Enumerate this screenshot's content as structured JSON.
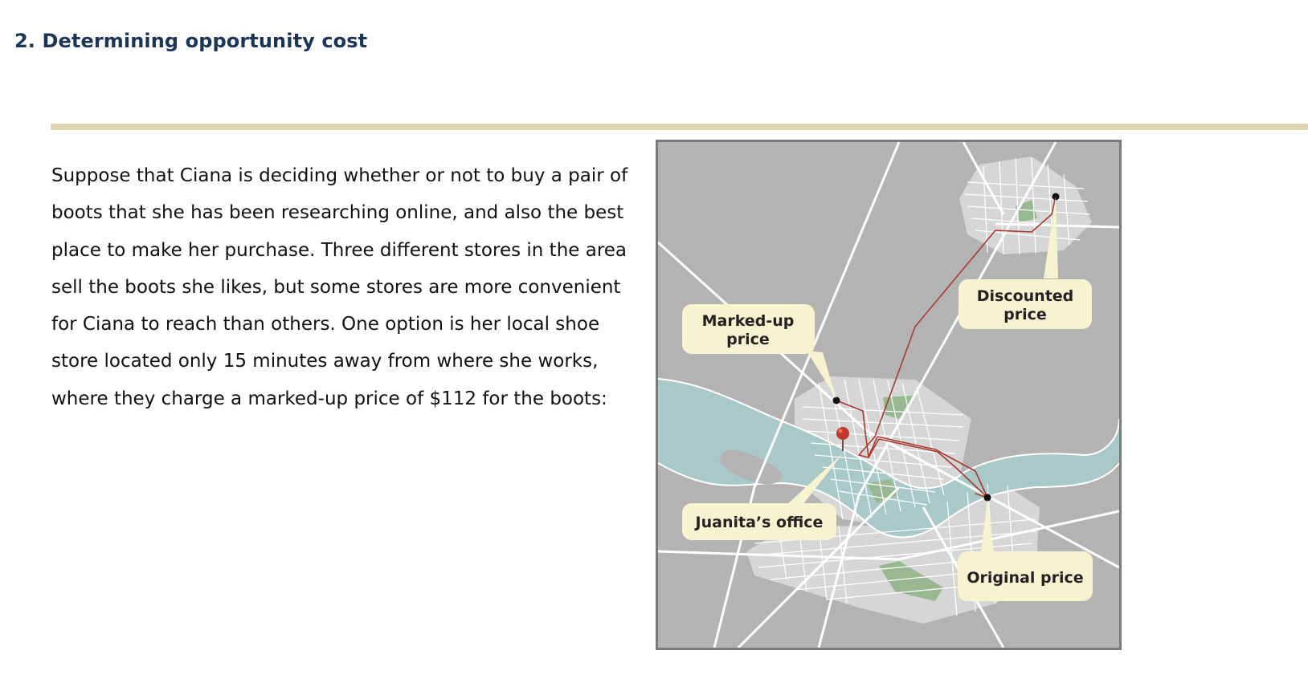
{
  "heading": "2. Determining opportunity cost",
  "passage": "Suppose that Ciana is deciding whether or not to buy a pair of boots that she has been researching online, and also the best place to make her purchase. Three different stores in the area sell the boots she likes, but some stores are more convenient for Ciana to reach than others. One option is her local shoe store located only 15 minutes away from where she works, where they charge a marked-up price of $112 for the boots:",
  "map": {
    "labels": {
      "marked_up_line1": "Marked-up",
      "marked_up_line2": "price",
      "discounted_line1": "Discounted",
      "discounted_line2": "price",
      "office": "Juanita’s office",
      "original": "Original price"
    },
    "colors": {
      "land": "#b3b3b3",
      "city": "#d6d6d6",
      "river": "#a9c9c9",
      "park": "#97b890",
      "route": "#a83a30",
      "callout": "#f6f3d0",
      "pin": "#c0392b"
    }
  }
}
